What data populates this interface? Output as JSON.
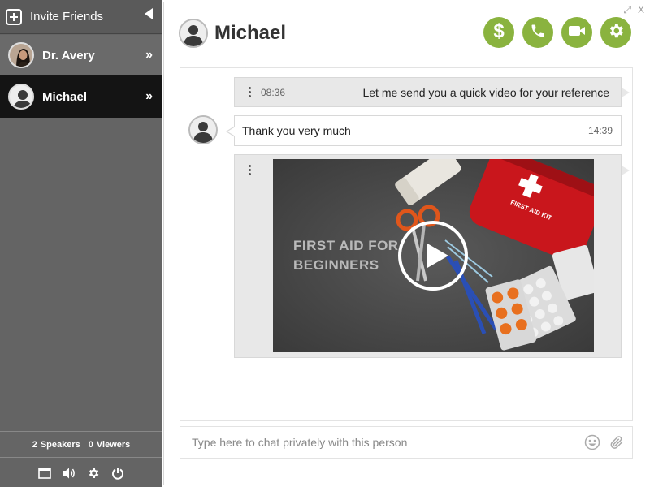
{
  "sidebar": {
    "invite_label": "Invite Friends",
    "contacts": [
      {
        "name": "Dr. Avery",
        "chevron": "»"
      },
      {
        "name": "Michael",
        "chevron": "»"
      }
    ],
    "counts": {
      "speakers_count": "2",
      "speakers_label": "Speakers",
      "viewers_count": "0",
      "viewers_label": "Viewers"
    },
    "toolbar_icons": [
      "window-icon",
      "volume-icon",
      "gear-icon",
      "power-icon"
    ]
  },
  "chat": {
    "title": "Michael",
    "window_controls": {
      "expand": "⤢",
      "close": "X"
    },
    "actions": [
      "dollar-icon",
      "phone-icon",
      "video-camera-icon",
      "gear-icon"
    ],
    "accent_color": "#8ab33f",
    "messages": [
      {
        "time": "08:36",
        "text": "Let me send you a quick video for your reference"
      },
      {
        "time": "14:39",
        "text": "Thank you very much"
      }
    ],
    "video": {
      "caption_line1": "FIRST AID FOR",
      "caption_line2": "BEGINNERS"
    },
    "composer": {
      "placeholder": "Type here to chat privately with this person"
    }
  }
}
